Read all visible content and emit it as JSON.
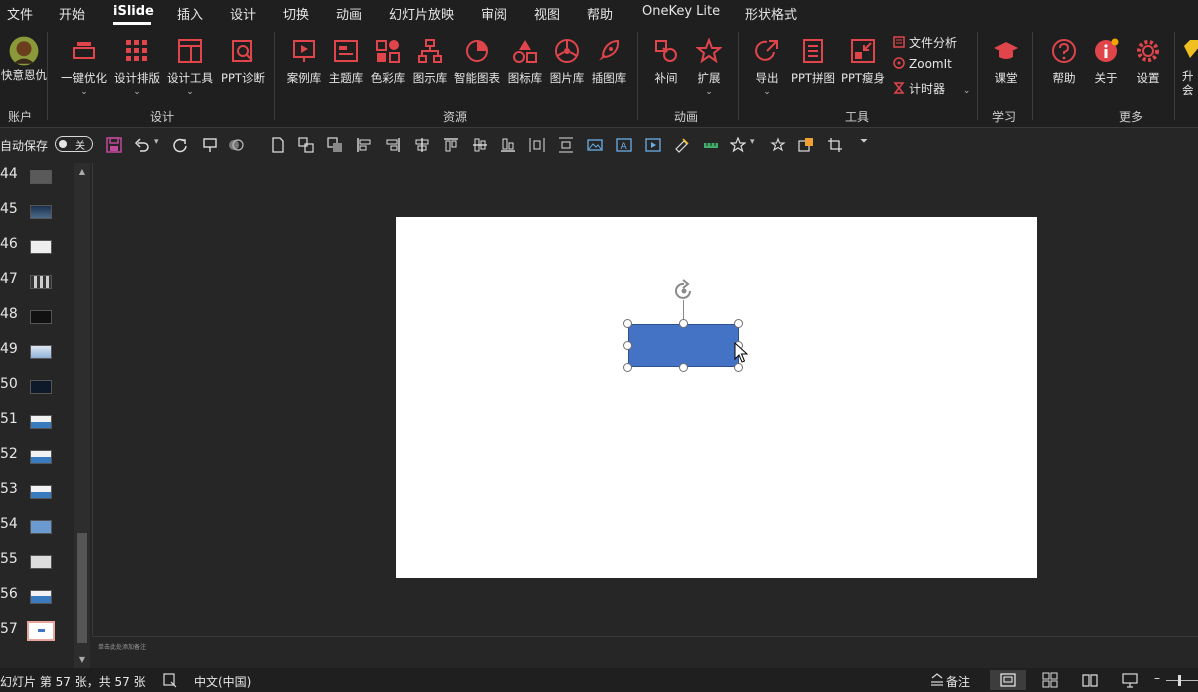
{
  "menubar": {
    "items": [
      "文件",
      "开始",
      "iSlide",
      "插入",
      "设计",
      "切换",
      "动画",
      "幻灯片放映",
      "审阅",
      "视图",
      "帮助",
      "OneKey Lite",
      "形状格式"
    ],
    "active": "iSlide"
  },
  "ribbon": {
    "account": {
      "label": "快意恩仇",
      "group": "账户"
    },
    "design": {
      "group": "设计",
      "buttons": [
        "一键优化",
        "设计排版",
        "设计工具",
        "PPT诊断"
      ]
    },
    "resources": {
      "group": "资源",
      "buttons": [
        "案例库",
        "主题库",
        "色彩库",
        "图示库",
        "智能图表",
        "图标库",
        "图片库",
        "插图库"
      ]
    },
    "animation": {
      "group": "动画",
      "buttons": [
        "补间",
        "扩展"
      ]
    },
    "tools": {
      "group": "工具",
      "buttons": [
        "导出",
        "PPT拼图",
        "PPT瘦身"
      ],
      "small": [
        "文件分析",
        "ZoomIt",
        "计时器"
      ]
    },
    "learn": {
      "group": "学习",
      "buttons": [
        "课堂"
      ]
    },
    "more": {
      "group": "更多",
      "buttons": [
        "帮助",
        "关于",
        "设置"
      ]
    },
    "upgrade": {
      "label": "升会"
    }
  },
  "qat": {
    "autosave_label": "自动保存",
    "toggle_state": "关"
  },
  "thumbnails": {
    "numbers": [
      "44",
      "45",
      "46",
      "47",
      "48",
      "49",
      "50",
      "51",
      "52",
      "53",
      "54",
      "55",
      "56",
      "57"
    ],
    "selected": "57"
  },
  "notes": {
    "placeholder": "单击此处添加备注"
  },
  "statusbar": {
    "slide_info": "幻灯片 第 57 张，共 57 张",
    "language": "中文(中国)",
    "notes_label": "备注"
  },
  "colors": {
    "accent_red": "#e0454b",
    "shape_fill": "#4472c4",
    "selected_thumb_border": "#e8a59a"
  }
}
